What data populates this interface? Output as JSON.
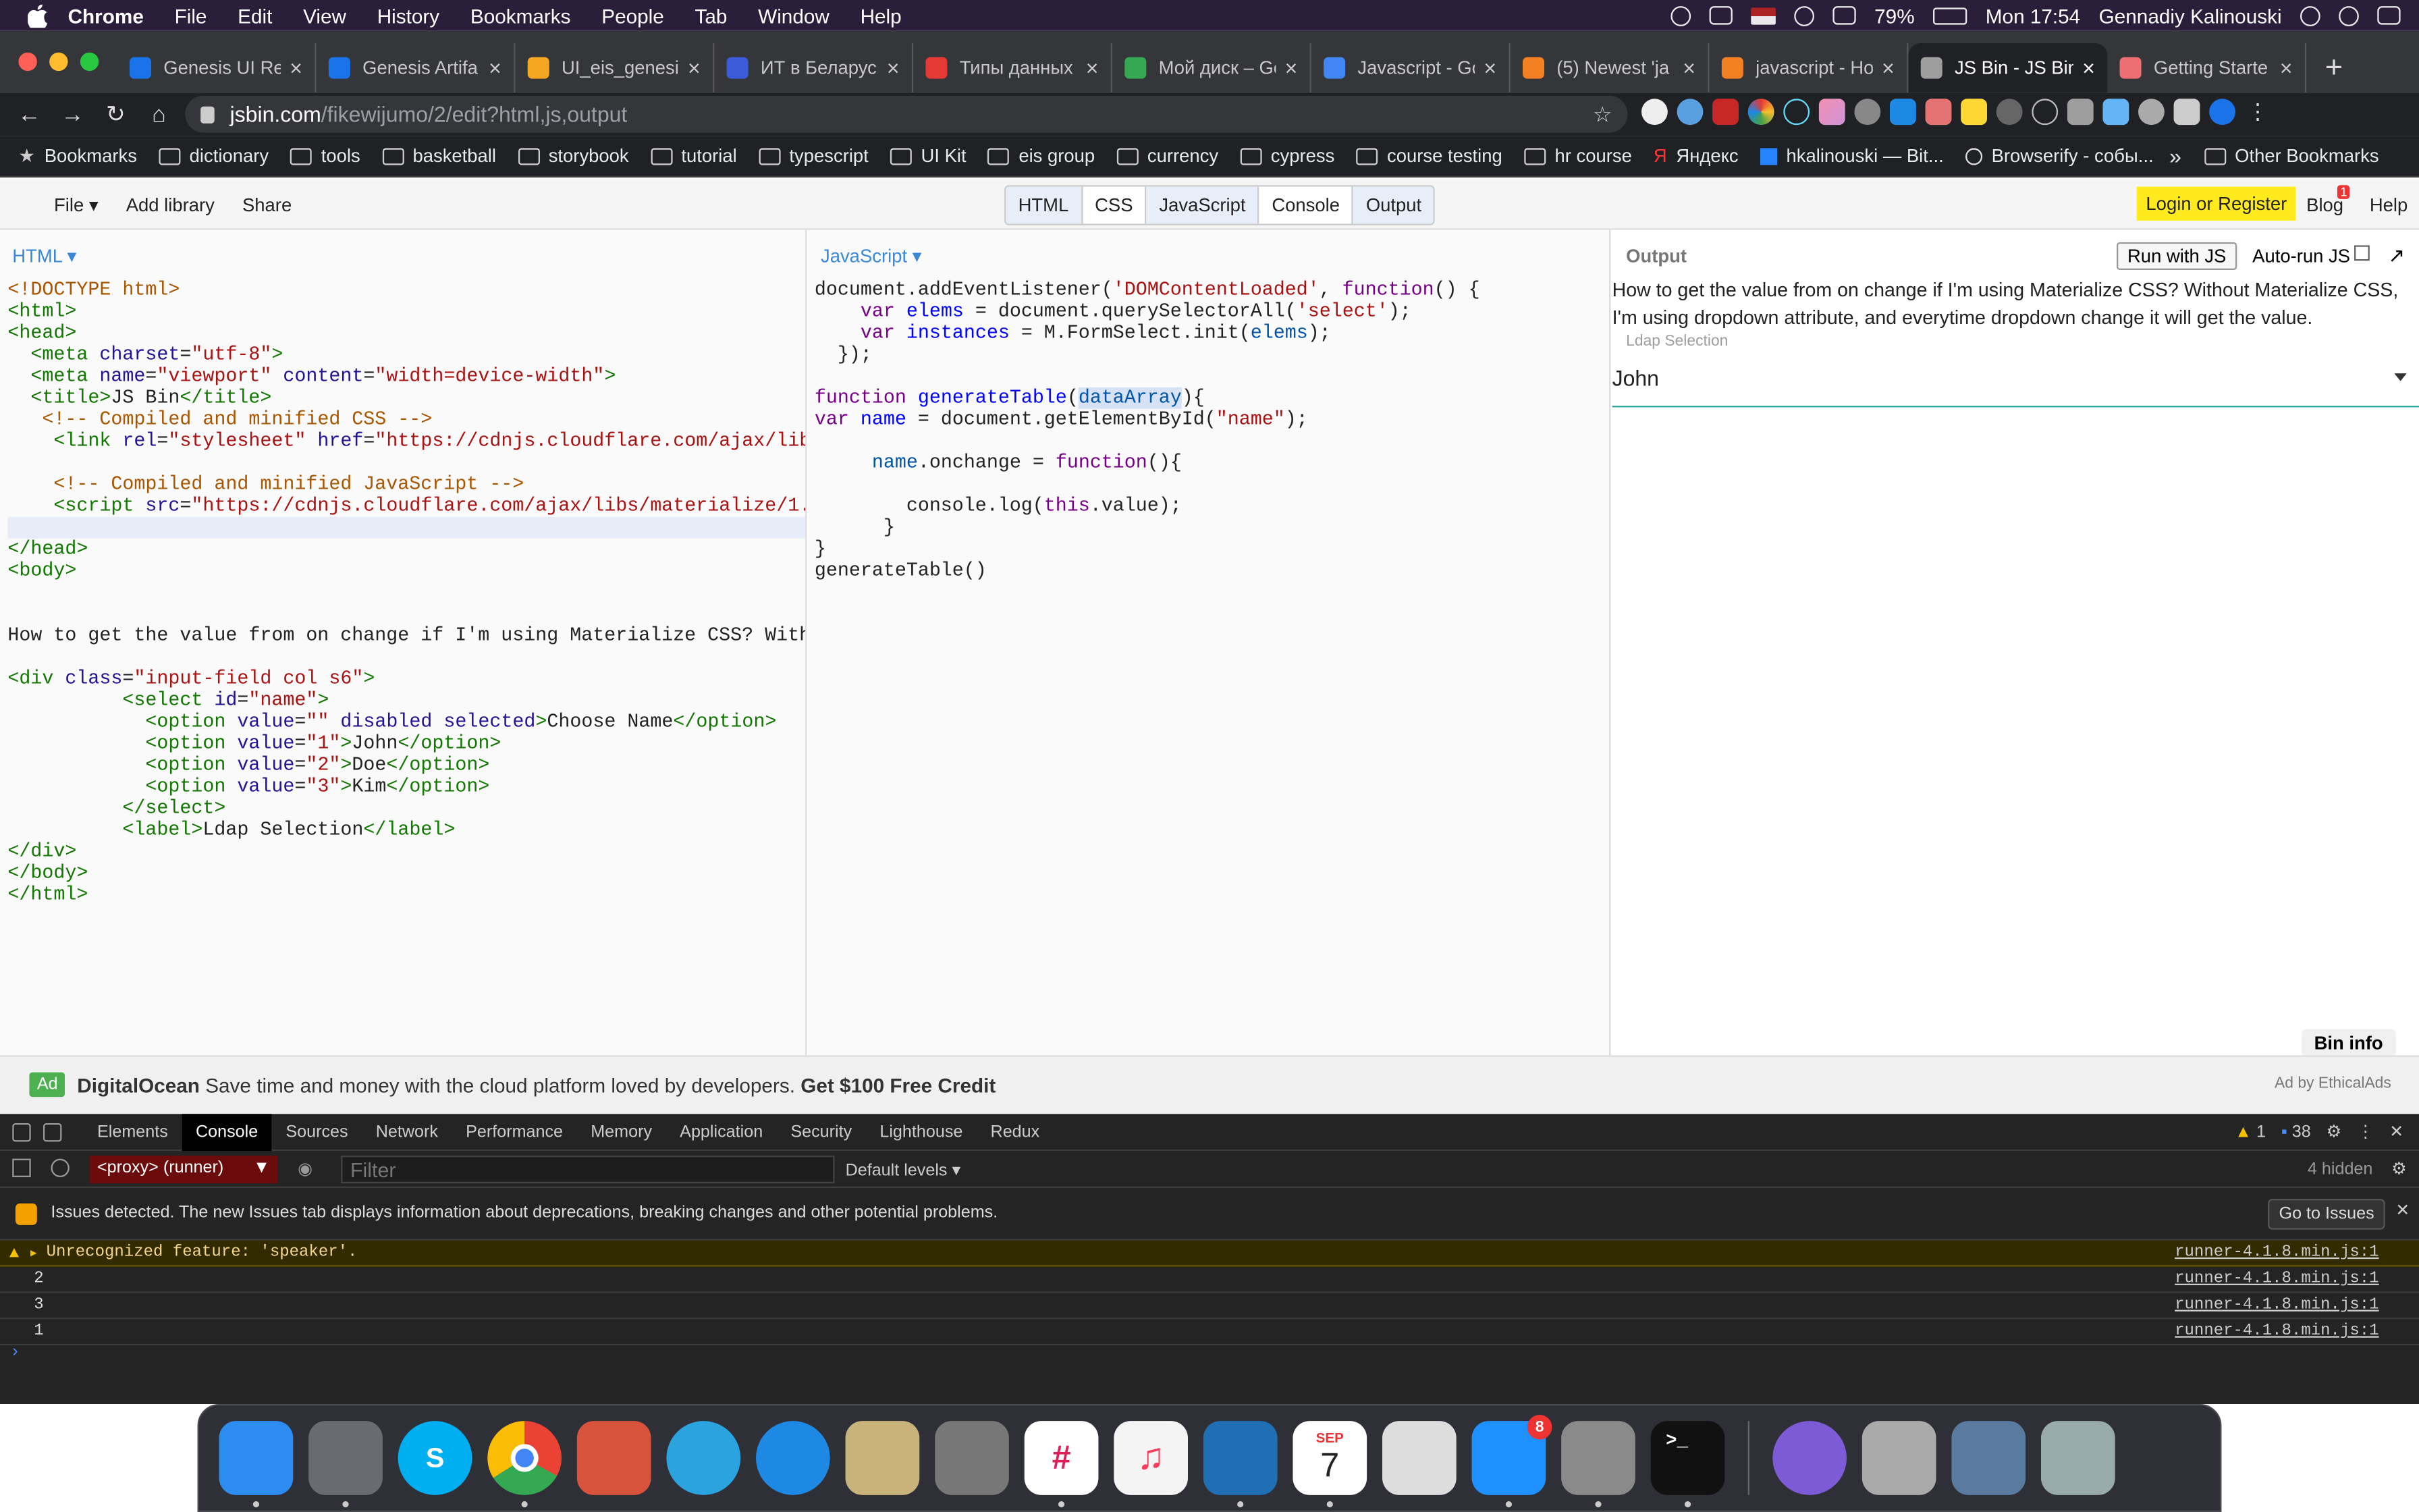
{
  "menubar": {
    "app": "Chrome",
    "items": [
      "File",
      "Edit",
      "View",
      "History",
      "Bookmarks",
      "People",
      "Tab",
      "Window",
      "Help"
    ],
    "battery": "79%",
    "time": "Mon 17:54",
    "user": "Gennadiy Kalinouski"
  },
  "tabs": [
    {
      "title": "Genesis UI Re",
      "color": "#1a73e8"
    },
    {
      "title": "Genesis Artifa",
      "color": "#1a73e8"
    },
    {
      "title": "UI_eis_genesis",
      "color": "#f5a623"
    },
    {
      "title": "ИТ в Беларусь",
      "color": "#3b5bdb"
    },
    {
      "title": "Типы данных",
      "color": "#e53935"
    },
    {
      "title": "Мой диск – Go",
      "color": "#34a853"
    },
    {
      "title": "Javascript - Go",
      "color": "#4285f4"
    },
    {
      "title": "(5) Newest 'ja",
      "color": "#f48024"
    },
    {
      "title": "javascript - Ho",
      "color": "#f48024"
    },
    {
      "title": "JS Bin - JS Bin",
      "color": "#9e9e9e",
      "active": true
    },
    {
      "title": "Getting Starte",
      "color": "#ee6e73"
    }
  ],
  "address": {
    "host": "jsbin.com",
    "path": "/fikewijumo/2/edit?html,js,output"
  },
  "bookmarks": {
    "first": "Bookmarks",
    "folders": [
      "dictionary",
      "tools",
      "basketball",
      "storybook",
      "tutorial",
      "typescript",
      "UI Kit",
      "eis group",
      "currency",
      "cypress",
      "course testing",
      "hr course"
    ],
    "links": [
      "Яндекс",
      "hkalinouski — Bit...",
      "Browserify - собы..."
    ],
    "overflow": "»",
    "other": "Other Bookmarks"
  },
  "jsbin": {
    "left": [
      "File ▾",
      "Add library",
      "Share"
    ],
    "panels": [
      "HTML",
      "CSS",
      "JavaScript",
      "Console",
      "Output"
    ],
    "login": "Login or Register",
    "blog": "Blog",
    "blog_badge": "1",
    "help": "Help"
  },
  "html_pane": {
    "label": "HTML ▾"
  },
  "js_pane": {
    "label": "JavaScript ▾"
  },
  "output": {
    "label": "Output",
    "run_button": "Run with JS",
    "autorun": "Auto-run JS",
    "popout": "↗",
    "text": "How to get the value from on change if I'm using Materialize CSS? Without Materialize CSS, I'm using dropdown attribute, and everytime dropdown change it will get the value.",
    "select_label": "Ldap Selection",
    "select_value": "John",
    "bin_info": "Bin info"
  },
  "ad": {
    "tag": "Ad",
    "brand": "DigitalOcean",
    "message": "Save time and money with the cloud platform loved by developers.",
    "cta": "Get $100 Free Credit",
    "by": "Ad by EthicalAds"
  },
  "devtools": {
    "tabs": [
      "Elements",
      "Console",
      "Sources",
      "Network",
      "Performance",
      "Memory",
      "Application",
      "Security",
      "Lighthouse",
      "Redux"
    ],
    "active_tab": "Console",
    "warnings": "1",
    "messages": "38",
    "context": "<proxy> (runner)",
    "filter_placeholder": "Filter",
    "levels": "Default levels ▾",
    "hidden": "4 hidden",
    "issues_text": "Issues detected. The new Issues tab displays information about deprecations, breaking changes and other potential problems.",
    "go_to_issues": "Go to Issues",
    "rows": [
      {
        "text": "Unrecognized feature: 'speaker'.",
        "source": "runner-4.1.8.min.js:1",
        "type": "warn"
      },
      {
        "text": "2",
        "source": "runner-4.1.8.min.js:1"
      },
      {
        "text": "3",
        "source": "runner-4.1.8.min.js:1"
      },
      {
        "text": "1",
        "source": "runner-4.1.8.min.js:1"
      }
    ],
    "prompt": "›"
  },
  "dock": [
    {
      "name": "finder",
      "color": "#2d8cf0"
    },
    {
      "name": "launchpad",
      "color": "#6a6a72"
    },
    {
      "name": "skype",
      "color": "#00aff0",
      "glyph": "S"
    },
    {
      "name": "chrome",
      "color": "#e8453c"
    },
    {
      "name": "remote-desktop",
      "color": "#d9533c"
    },
    {
      "name": "telegram",
      "color": "#2aa3df"
    },
    {
      "name": "safari",
      "color": "#1e88e5"
    },
    {
      "name": "mail",
      "color": "#c9b37a"
    },
    {
      "name": "calculator",
      "color": "#777"
    },
    {
      "name": "slack",
      "color": "#ffffff"
    },
    {
      "name": "music",
      "color": "#f4f4f4"
    },
    {
      "name": "vscode",
      "color": "#1f6fb5"
    },
    {
      "name": "calendar",
      "color": "#fff",
      "month": "SEP",
      "day": "7"
    },
    {
      "name": "screenshot",
      "color": "#ddd"
    },
    {
      "name": "app-store",
      "color": "#1e90ff",
      "badge": "8"
    },
    {
      "name": "system-preferences",
      "color": "#8a8a8a"
    },
    {
      "name": "terminal",
      "color": "#111",
      "glyph": ">_"
    },
    {
      "name": "viber",
      "color": "#7d5bd6"
    },
    {
      "name": "image-capture",
      "color": "#aaa"
    },
    {
      "name": "downloads",
      "color": "#5a7aa0"
    },
    {
      "name": "trash",
      "color": "#9aa"
    }
  ]
}
